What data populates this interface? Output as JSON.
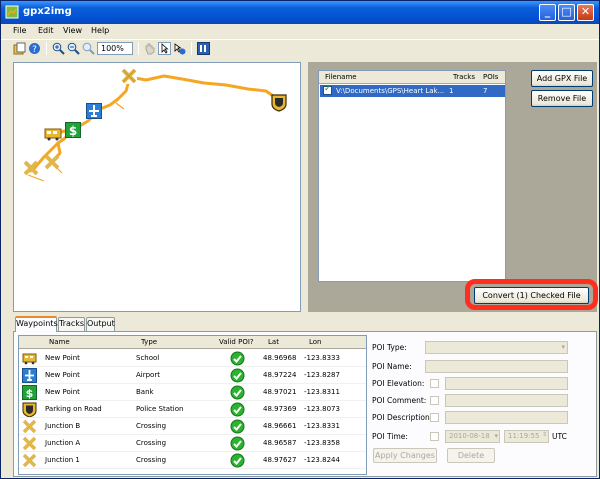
{
  "window": {
    "title": "gpx2img"
  },
  "menu": [
    "File",
    "Edit",
    "View",
    "Help"
  ],
  "toolbar": {
    "zoom": "100%"
  },
  "file_list": {
    "headers": {
      "filename": "Filename",
      "tracks": "Tracks",
      "pois": "POIs"
    },
    "rows": [
      {
        "checked": true,
        "filename": "V:\\Documents\\GPS\\Heart Lak...",
        "tracks": "1",
        "pois": "7"
      }
    ]
  },
  "buttons": {
    "add_gpx": "Add GPX File",
    "remove_file": "Remove File",
    "convert": "Convert (1) Checked File",
    "apply_changes": "Apply Changes",
    "delete": "Delete"
  },
  "tabs": [
    "Waypoints",
    "Tracks",
    "Output"
  ],
  "waypoints": {
    "headers": {
      "name": "Name",
      "type": "Type",
      "valid": "Valid POI?",
      "lat": "Lat",
      "lon": "Lon"
    },
    "rows": [
      {
        "icon": "bus-icon",
        "name": "New Point",
        "type": "School",
        "valid": true,
        "lat": "48.96968",
        "lon": "-123.8333"
      },
      {
        "icon": "airport-icon",
        "name": "New Point",
        "type": "Airport",
        "valid": true,
        "lat": "48.97224",
        "lon": "-123.8287"
      },
      {
        "icon": "dollar-icon",
        "name": "New Point",
        "type": "Bank",
        "valid": true,
        "lat": "48.97021",
        "lon": "-123.8311"
      },
      {
        "icon": "police-badge-icon",
        "name": "Parking on Road",
        "type": "Police Station",
        "valid": true,
        "lat": "48.97369",
        "lon": "-123.8073"
      },
      {
        "icon": "crossing-icon",
        "name": "Junction B",
        "type": "Crossing",
        "valid": true,
        "lat": "48.96661",
        "lon": "-123.8331"
      },
      {
        "icon": "crossing-icon",
        "name": "Junction A",
        "type": "Crossing",
        "valid": true,
        "lat": "48.96587",
        "lon": "-123.8358"
      },
      {
        "icon": "crossing-icon",
        "name": "Junction 1",
        "type": "Crossing",
        "valid": true,
        "lat": "48.97627",
        "lon": "-123.8244"
      }
    ]
  },
  "poi_form": {
    "type_label": "POI Type:",
    "name_label": "POI Name:",
    "elevation_label": "POI Elevation:",
    "comment_label": "POI Comment:",
    "description_label": "POI Description:",
    "time_label": "POI Time:",
    "date_value": "2010-08-18",
    "time_value": "11:19:55",
    "utc": "UTC"
  },
  "colors": {
    "highlight": "#ff2f1f",
    "track": "#f5a623",
    "selection": "#316ac5"
  }
}
